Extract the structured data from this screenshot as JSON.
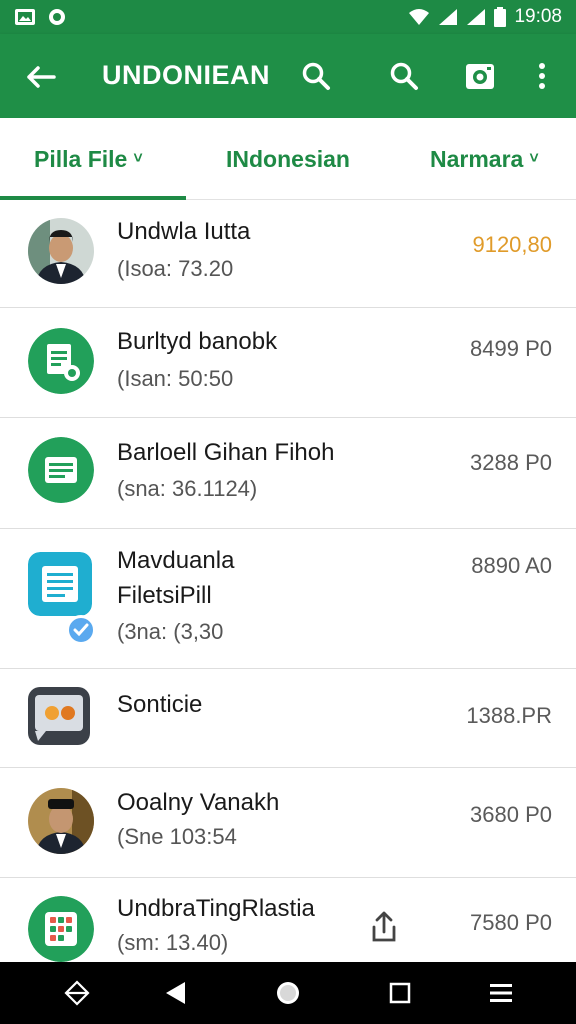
{
  "status_bar": {
    "time": "19:08",
    "icons": [
      "gallery-icon",
      "record-icon",
      "wifi-icon",
      "signal-icon",
      "signal-icon",
      "battery-icon"
    ]
  },
  "app_bar": {
    "title": "UNDONIEAN",
    "actions": [
      "search-icon",
      "search-icon",
      "camera-icon",
      "more-vert-icon"
    ]
  },
  "tabs": [
    {
      "label": "Pilla File",
      "chevron": "˅",
      "selected": true
    },
    {
      "label": "INdonesian",
      "chevron": "",
      "selected": false
    },
    {
      "label": "Narmara",
      "chevron": "˅",
      "selected": false
    }
  ],
  "list": [
    {
      "name": "Undwla Iutta",
      "sub": "(Isoa: 73.20",
      "amount": "9120,80",
      "icon": "person-avatar",
      "highlight": true
    },
    {
      "name": "Burltyd banobk",
      "sub": "(Isan: 50:50",
      "amount": "8499 P0",
      "icon": "document-icon"
    },
    {
      "name": "Barloell Gihan Fihoh",
      "sub": "(sna: 36.1124)",
      "amount": "3288 P0",
      "icon": "list-icon"
    },
    {
      "name": "Mavduanla",
      "name2": "FiletsiPill",
      "sub": "(3na: (3,30",
      "amount": "8890 A0",
      "icon": "file-icon",
      "badge": "check-icon"
    },
    {
      "name": "Sonticie",
      "sub": "",
      "amount": "1388.PR",
      "icon": "media-icon"
    },
    {
      "name": "Ooalny Vanakh",
      "sub": "(Sne 103:54",
      "amount": "3680 P0",
      "icon": "person-avatar"
    },
    {
      "name": "UndbraTingRlastia",
      "sub": "(sm: 13.40)",
      "amount": "7580 P0",
      "icon": "grid-icon",
      "extra_icon": "share-icon"
    }
  ],
  "colors": {
    "primary": "#1f8f47",
    "accent_amount": "#e09b2a",
    "badge_blue": "#5aa9ef"
  }
}
